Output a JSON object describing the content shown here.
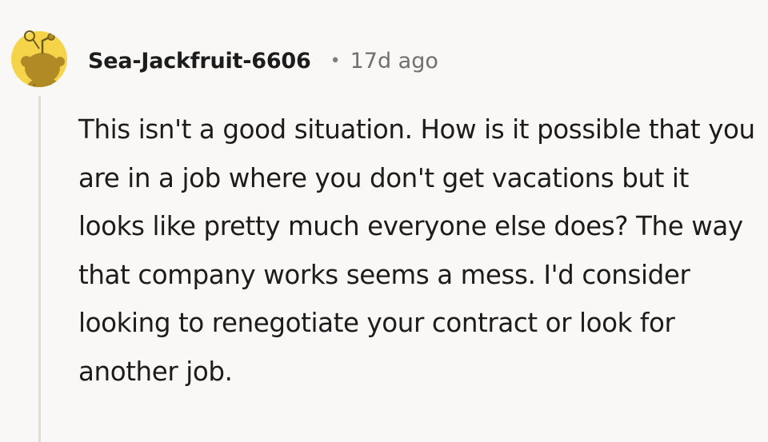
{
  "comment": {
    "author": "Sea-Jackfruit-6606",
    "separator": "•",
    "age": "17d ago",
    "text": "This isn't a good situation. How is it possible that you are in a job where you don't get vacations but it looks like pretty much everyone else does? The way that company works seems a mess. I'd consider looking to renegotiate your contract or look for another job."
  },
  "colors": {
    "background": "#f9f8f7",
    "avatar_bg": "#f6d44a",
    "avatar_snoo": "#b08a25",
    "thread_line": "#e3ddd8"
  },
  "icons": {
    "avatar": "snoo-avatar-icon"
  }
}
